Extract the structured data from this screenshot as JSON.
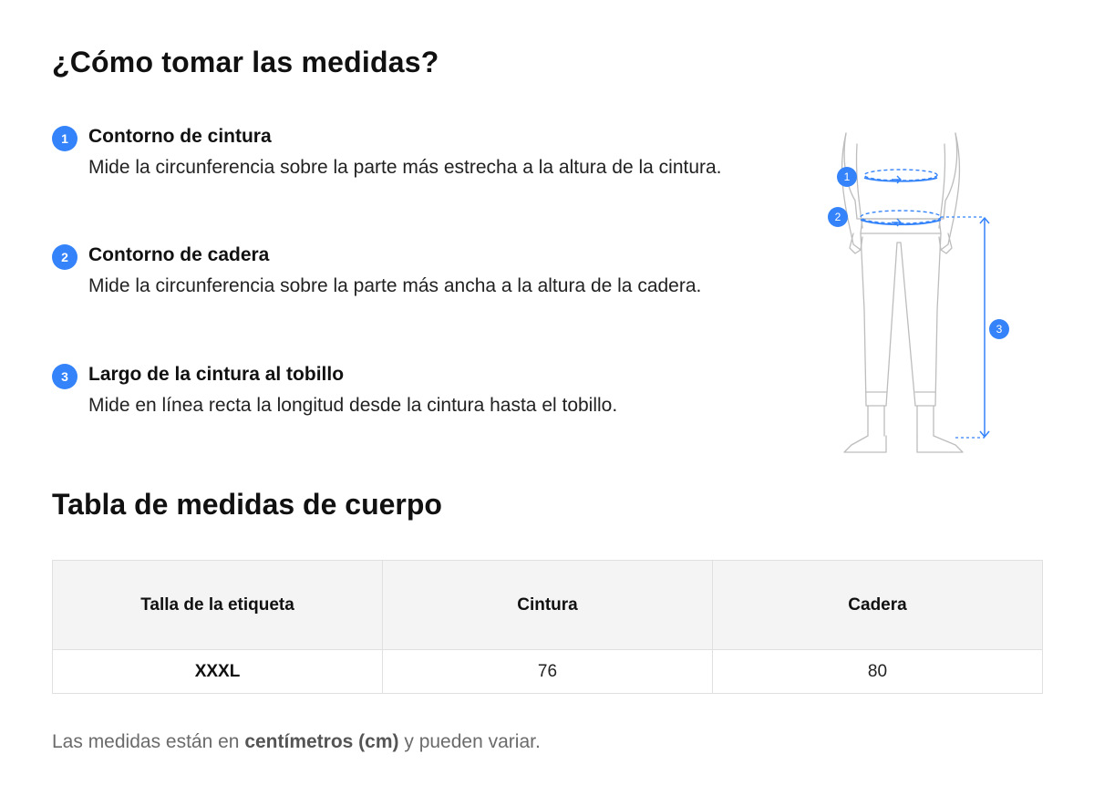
{
  "guide": {
    "title": "¿Cómo tomar las medidas?",
    "steps": [
      {
        "number": "1",
        "title": "Contorno de cintura",
        "description": "Mide la circunferencia sobre la parte más estrecha a la altura de la cintura."
      },
      {
        "number": "2",
        "title": "Contorno de cadera",
        "description": "Mide la circunferencia sobre la parte más ancha a la altura de la cadera."
      },
      {
        "number": "3",
        "title": "Largo de la cintura al tobillo",
        "description": "Mide en línea recta la longitud desde la cintura hasta el tobillo."
      }
    ],
    "figure_markers": [
      "1",
      "2",
      "3"
    ]
  },
  "table": {
    "title": "Tabla de medidas de cuerpo",
    "headers": [
      "Talla de la etiqueta",
      "Cintura",
      "Cadera"
    ],
    "rows": [
      [
        "XXXL",
        "76",
        "80"
      ]
    ]
  },
  "note": {
    "prefix": "Las medidas están en ",
    "unit": "centímetros (cm)",
    "suffix": " y pueden variar."
  },
  "colors": {
    "accent": "#3483fa",
    "header_bg": "#f4f4f4",
    "muted_text": "#6b6b6b"
  }
}
